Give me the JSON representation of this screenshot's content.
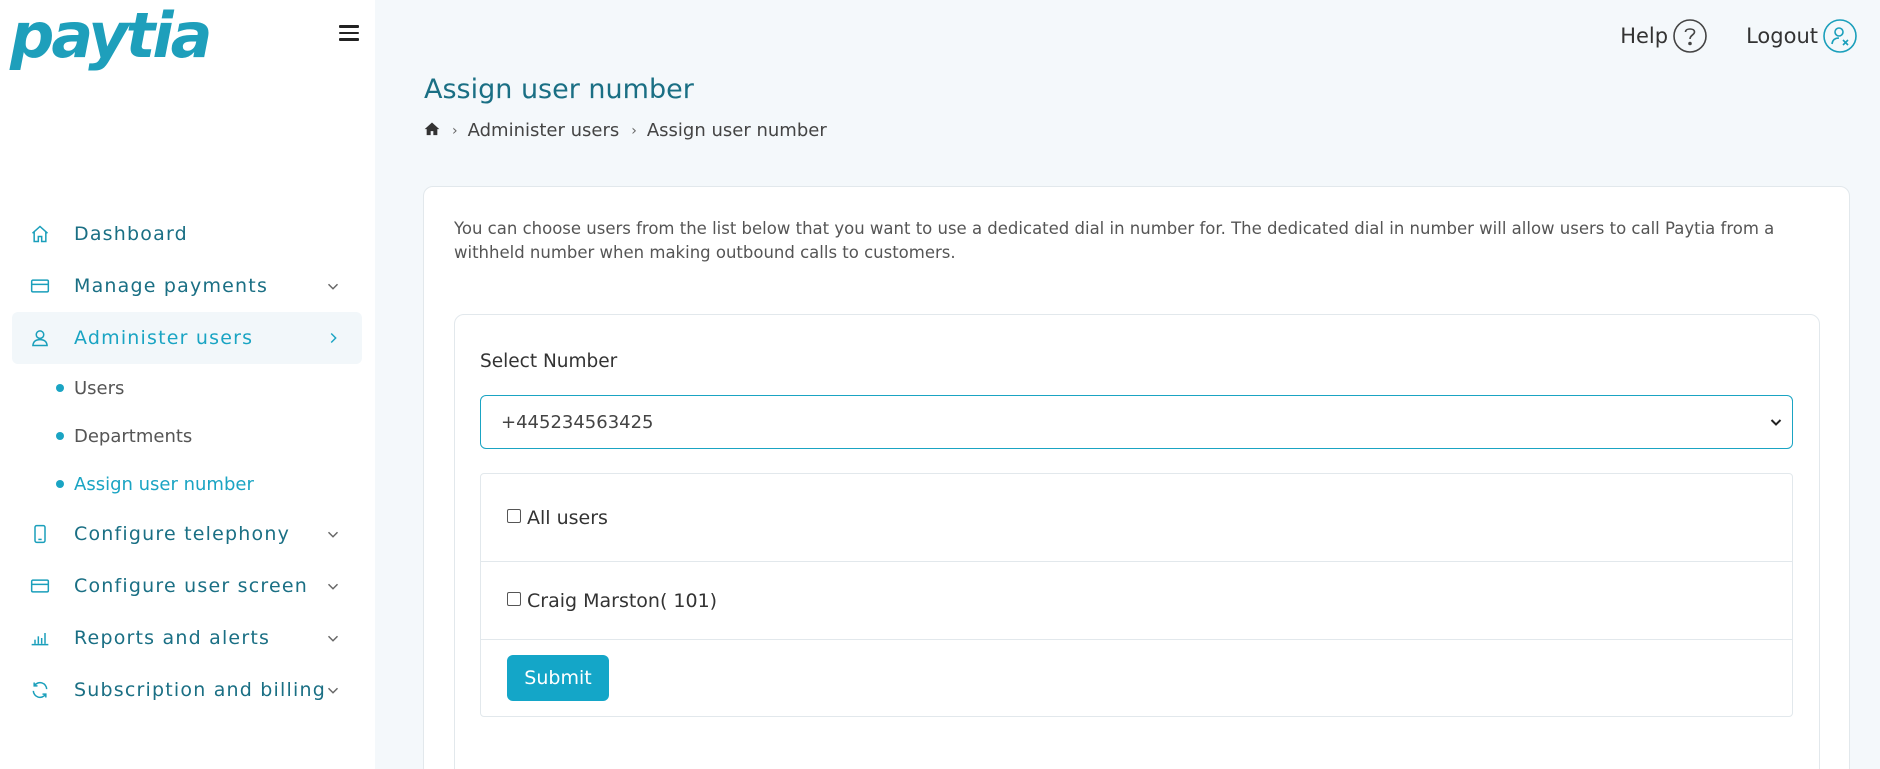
{
  "brand": {
    "logo_text": "paytia"
  },
  "header": {
    "help_label": "Help",
    "logout_label": "Logout"
  },
  "sidebar": {
    "items": [
      {
        "label": "Dashboard",
        "icon": "home-icon"
      },
      {
        "label": "Manage payments",
        "icon": "card-icon"
      },
      {
        "label": "Administer users",
        "icon": "user-icon"
      },
      {
        "label": "Configure telephony",
        "icon": "phone-icon"
      },
      {
        "label": "Configure user screen",
        "icon": "card-icon"
      },
      {
        "label": "Reports and alerts",
        "icon": "bar-chart-icon"
      },
      {
        "label": "Subscription and billing",
        "icon": "refresh-icon"
      }
    ],
    "subitems": [
      {
        "label": "Users"
      },
      {
        "label": "Departments"
      },
      {
        "label": "Assign user number"
      }
    ]
  },
  "page": {
    "title": "Assign user number",
    "breadcrumb": [
      "Administer users",
      "Assign user number"
    ],
    "intro": "You can choose users from the list below that you want to use a dedicated dial in number for. The dedicated dial in number will allow users to call Paytia from a withheld number when making outbound calls to customers.",
    "select_label": "Select Number",
    "select_value": "+445234563425",
    "checkbox_rows": [
      {
        "label": "All users"
      },
      {
        "label": "Craig Marston( 101)"
      }
    ],
    "submit_label": "Submit"
  },
  "colors": {
    "accent": "#1aa4c3",
    "nav_text": "#1a6f84",
    "background": "#f4f8fb"
  }
}
